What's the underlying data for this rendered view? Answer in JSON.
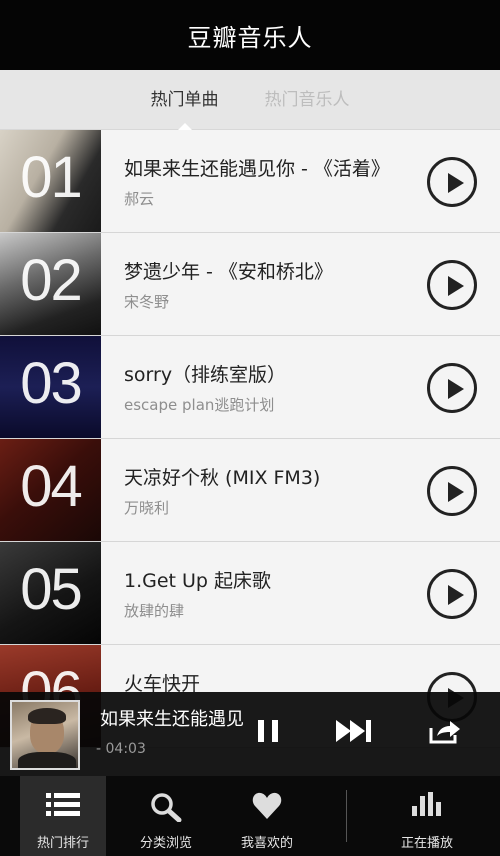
{
  "header": {
    "title": "豆瓣音乐人"
  },
  "tabs": [
    {
      "label": "热门单曲",
      "active": true
    },
    {
      "label": "热门音乐人",
      "active": false
    }
  ],
  "songs": [
    {
      "rank": "01",
      "title": "如果来生还能遇见你 - 《活着》",
      "artist": "郝云",
      "thumb_colors": [
        "#2b2b2b",
        "#c9c3b7"
      ]
    },
    {
      "rank": "02",
      "title": "梦遗少年 - 《安和桥北》",
      "artist": "宋冬野",
      "thumb_colors": [
        "#1a1a1a",
        "#7a7a7a"
      ]
    },
    {
      "rank": "03",
      "title": "sorry（排练室版）",
      "artist": "escape plan逃跑计划",
      "thumb_colors": [
        "#0d0d35",
        "#2a2f6a"
      ]
    },
    {
      "rank": "04",
      "title": "天凉好个秋 (MIX FM3)",
      "artist": "万晓利",
      "thumb_colors": [
        "#3a0e0a",
        "#8a2a1c"
      ]
    },
    {
      "rank": "05",
      "title": "1.Get Up 起床歌",
      "artist": "放肆的肆",
      "thumb_colors": [
        "#111111",
        "#4a4a4a"
      ]
    },
    {
      "rank": "06",
      "title": "火车快开",
      "artist": "",
      "thumb_colors": [
        "#5a1a12",
        "#a43a2a"
      ]
    }
  ],
  "player": {
    "title": "如果来生还能遇见",
    "time": "- 04:03"
  },
  "bottom_nav": [
    {
      "label": "热门排行",
      "icon": "list-icon",
      "active": true
    },
    {
      "label": "分类浏览",
      "icon": "search-icon",
      "active": false
    },
    {
      "label": "我喜欢的",
      "icon": "heart-icon",
      "active": false
    },
    {
      "label": "正在播放",
      "icon": "bars-icon",
      "active": false
    }
  ],
  "colors": {
    "header_bg": "#050505",
    "bottom_bg": "#0a0a0a",
    "text_primary": "#222222",
    "text_secondary": "#8e8e8e"
  }
}
